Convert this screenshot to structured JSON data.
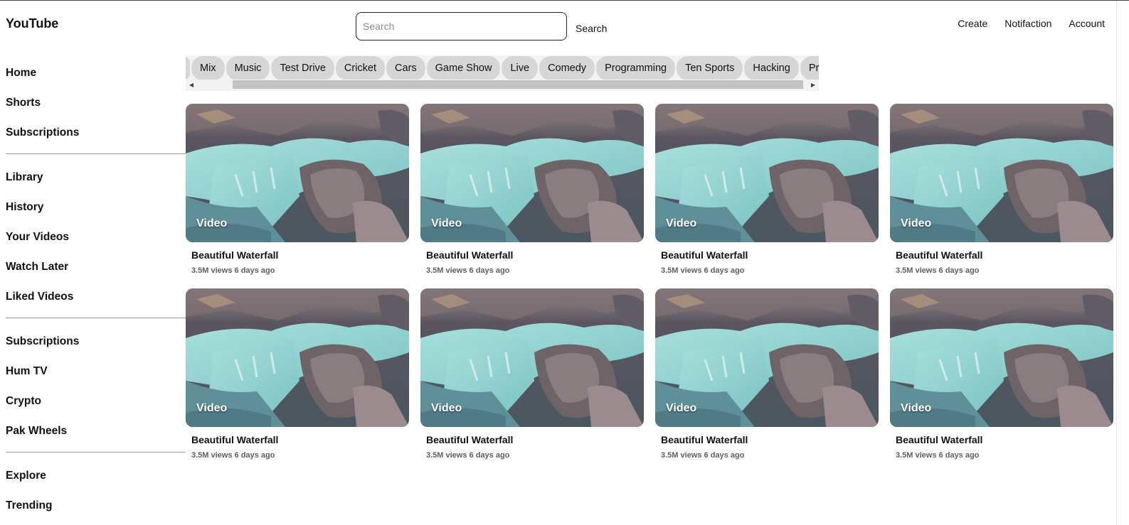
{
  "header": {
    "logo": "YouTube",
    "search_placeholder": "Search",
    "search_button": "Search",
    "actions": [
      "Create",
      "Notifaction",
      "Account"
    ]
  },
  "sidebar": {
    "groups": [
      [
        "Home",
        "Shorts",
        "Subscriptions"
      ],
      [
        "Library",
        "History",
        "Your Videos",
        "Watch Later",
        "Liked Videos"
      ],
      [
        "Subscriptions",
        "Hum TV",
        "Crypto",
        "Pak Wheels"
      ],
      [
        "Explore",
        "Trending"
      ]
    ]
  },
  "tags": [
    "Mix",
    "Music",
    "Test Drive",
    "Cricket",
    "Cars",
    "Game Show",
    "Live",
    "Comedy",
    "Programming",
    "Ten Sports",
    "Hacking",
    "Property"
  ],
  "videos": [
    {
      "label": "Video",
      "title": "Beautiful Waterfall",
      "meta": "3.5M views 6 days ago"
    },
    {
      "label": "Video",
      "title": "Beautiful Waterfall",
      "meta": "3.5M views 6 days ago"
    },
    {
      "label": "Video",
      "title": "Beautiful Waterfall",
      "meta": "3.5M views 6 days ago"
    },
    {
      "label": "Video",
      "title": "Beautiful Waterfall",
      "meta": "3.5M views 6 days ago"
    },
    {
      "label": "Video",
      "title": "Beautiful Waterfall",
      "meta": "3.5M views 6 days ago"
    },
    {
      "label": "Video",
      "title": "Beautiful Waterfall",
      "meta": "3.5M views 6 days ago"
    },
    {
      "label": "Video",
      "title": "Beautiful Waterfall",
      "meta": "3.5M views 6 days ago"
    },
    {
      "label": "Video",
      "title": "Beautiful Waterfall",
      "meta": "3.5M views 6 days ago"
    }
  ],
  "colors": {
    "water": "#7cc4c4",
    "rock": "#5a5560",
    "tag_bg": "#d6d6d6"
  },
  "icons": {
    "scroll_left": "triangle-left-icon",
    "scroll_right": "triangle-right-icon"
  }
}
